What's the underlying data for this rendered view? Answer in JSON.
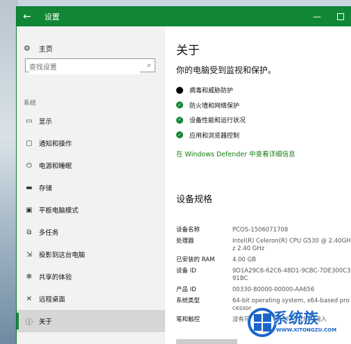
{
  "window": {
    "title": "设置",
    "back_icon": "arrow-left-icon",
    "minimize_glyph": "—",
    "accent_color": "#118736"
  },
  "sidebar": {
    "home_label": "主页",
    "home_icon": "gear-icon",
    "search_placeholder": "查找设置",
    "section_label": "系统",
    "items": [
      {
        "label": "显示",
        "icon": "monitor-icon",
        "glyph": "▭"
      },
      {
        "label": "通知和操作",
        "icon": "notification-icon",
        "glyph": "▢"
      },
      {
        "label": "电源和睡眠",
        "icon": "power-icon",
        "glyph": "⏻"
      },
      {
        "label": "存储",
        "icon": "storage-icon",
        "glyph": "▬"
      },
      {
        "label": "平板电脑模式",
        "icon": "tablet-icon",
        "glyph": "▣"
      },
      {
        "label": "多任务",
        "icon": "multitask-icon",
        "glyph": "⧉"
      },
      {
        "label": "投影到这台电脑",
        "icon": "project-icon",
        "glyph": "⇲"
      },
      {
        "label": "共享的体验",
        "icon": "share-icon",
        "glyph": "✻"
      },
      {
        "label": "远程桌面",
        "icon": "remote-desktop-icon",
        "glyph": "✕"
      },
      {
        "label": "关于",
        "icon": "info-icon",
        "glyph": "ⓘ",
        "active": true
      }
    ]
  },
  "main": {
    "title": "关于",
    "protection_heading": "你的电脑受到监视和保护。",
    "status_items": [
      {
        "label": "病毒和威胁防护",
        "state": "warning"
      },
      {
        "label": "防火墙和网络保护",
        "state": "ok"
      },
      {
        "label": "设备性能和运行状况",
        "state": "ok"
      },
      {
        "label": "应用和浏览器控制",
        "state": "ok"
      }
    ],
    "defender_link": "在 Windows Defender 中查看详细信息",
    "specs_heading": "设备规格",
    "specs": [
      {
        "key": "设备名称",
        "value": "PCOS-1506071708"
      },
      {
        "key": "处理器",
        "value": "Intel(R) Celeron(R) CPU G530 @ 2.40GHz   2.40 GHz"
      },
      {
        "key": "已安装的 RAM",
        "value": "4.00 GB"
      },
      {
        "key": "设备 ID",
        "value": "9D1A29C6-62C6-48D1-9CBC-7DE300C391BC"
      },
      {
        "key": "产品 ID",
        "value": "00330-80000-00000-AA656"
      },
      {
        "key": "系统类型",
        "value": "64-bit operating system, x64-based processor"
      },
      {
        "key": "笔和触控",
        "value": "没有可用于此显示器的笔或触控输入"
      }
    ]
  },
  "watermark": {
    "text": "系统族",
    "url": "WWW.XITONGZU.COM",
    "color": "#1a66c8"
  }
}
